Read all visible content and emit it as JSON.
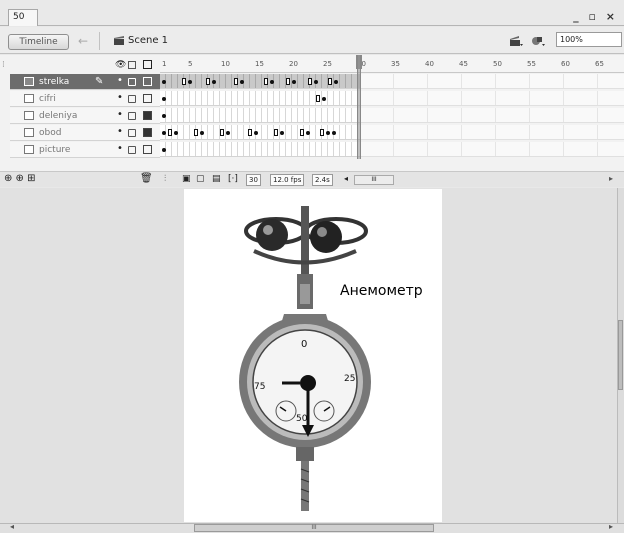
{
  "document": {
    "tab_label": "50"
  },
  "window": {
    "controls": "_ ▫ ×"
  },
  "editbar": {
    "timeline_button": "Timeline",
    "back_icon": "arrow-left-icon",
    "scene_label": "Scene 1",
    "zoom": "100%"
  },
  "timeline": {
    "ruler_labels": [
      "1",
      "5",
      "10",
      "15",
      "20",
      "25",
      "30",
      "35",
      "40",
      "45",
      "50",
      "55",
      "60",
      "65"
    ],
    "layers": [
      {
        "name": "strelka",
        "selected": true,
        "pencil": true,
        "outline_filled": false
      },
      {
        "name": "cifri",
        "selected": false,
        "pencil": false,
        "outline_filled": false
      },
      {
        "name": "deleniya",
        "selected": false,
        "pencil": false,
        "outline_filled": true
      },
      {
        "name": "obod",
        "selected": false,
        "pencil": false,
        "outline_filled": true
      },
      {
        "name": "picture",
        "selected": false,
        "pencil": false,
        "outline_filled": false
      }
    ],
    "current_frame": "30",
    "fps": "12.0 fps",
    "elapsed": "2.4s",
    "scroll_thumb": "III"
  },
  "stage": {
    "label": "Анемометр",
    "scroll_thumb": "III"
  },
  "colors": {
    "selected_layer": "#6c6c6c",
    "stage_bg": "#e1e1e1",
    "canvas": "#ffffff"
  }
}
